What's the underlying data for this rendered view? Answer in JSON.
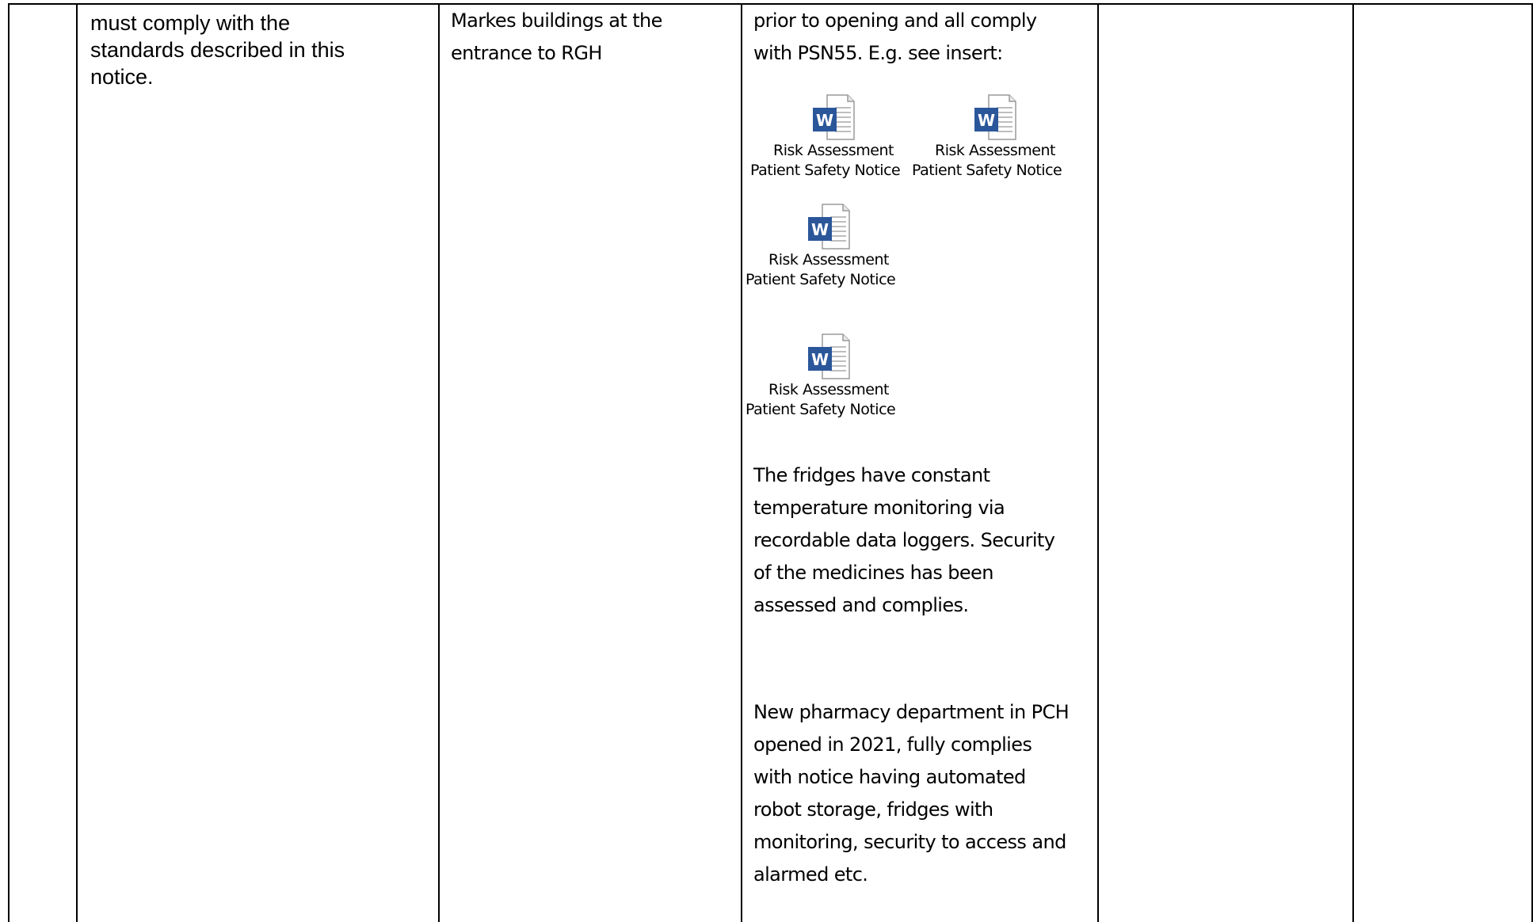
{
  "table": {
    "row": {
      "col2_lines": [
        "must comply with the",
        "standards described in this",
        "notice."
      ],
      "col3_lines": [
        "Markes buildings at the",
        "entrance to RGH"
      ],
      "col4_intro_lines": [
        "prior to opening and all comply",
        "with PSN55. E.g. see insert:"
      ],
      "attachments": [
        {
          "caption_line1": "Risk Assessment",
          "caption_line2": "Patient Safety Notice",
          "icon": "word-document-icon"
        },
        {
          "caption_line1": "Risk Assessment",
          "caption_line2": "Patient Safety Notice",
          "icon": "word-document-icon"
        },
        {
          "caption_line1": "Risk Assessment",
          "caption_line2": "Patient Safety Notice",
          "icon": "word-document-icon"
        },
        {
          "caption_line1": "Risk Assessment",
          "caption_line2": "Patient Safety Notice",
          "icon": "word-document-icon"
        }
      ],
      "col4_para1_lines": [
        "The fridges have constant",
        "temperature monitoring via",
        "recordable data loggers. Security",
        "of the medicines has been",
        "assessed and complies."
      ],
      "col4_para2_lines": [
        "New pharmacy department in PCH",
        "opened in 2021, fully complies",
        "with notice having automated",
        "robot storage, fridges with",
        "monitoring, security to access and",
        "alarmed etc."
      ]
    }
  },
  "colors": {
    "word_blue": "#2b579a",
    "border": "#000000"
  }
}
